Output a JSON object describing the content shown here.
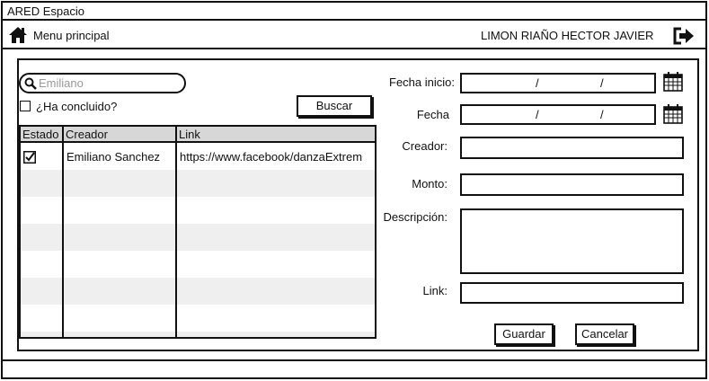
{
  "window": {
    "title": "ARED Espacio"
  },
  "nav": {
    "menu_label": "Menu principal",
    "user_name": "LIMON RIAÑO HECTOR JAVIER"
  },
  "search": {
    "value": "Emiliano",
    "checkbox_label": "¿Ha concluido?",
    "checked": false,
    "button_label": "Buscar"
  },
  "table": {
    "headers": [
      "Estado",
      "Creador",
      "Link"
    ],
    "rows": [
      {
        "estado_checked": true,
        "creador": "Emiliano Sanchez",
        "link": "https://www.facebook/danzaExtrem"
      },
      {
        "estado_checked": false,
        "creador": "",
        "link": ""
      },
      {
        "estado_checked": false,
        "creador": "",
        "link": ""
      },
      {
        "estado_checked": false,
        "creador": "",
        "link": ""
      },
      {
        "estado_checked": false,
        "creador": "",
        "link": ""
      },
      {
        "estado_checked": false,
        "creador": "",
        "link": ""
      },
      {
        "estado_checked": false,
        "creador": "",
        "link": ""
      },
      {
        "estado_checked": false,
        "creador": "",
        "link": ""
      }
    ]
  },
  "form": {
    "fecha_inicio_label": "Fecha inicio:",
    "fecha_label": "Fecha",
    "date_separator": "/",
    "creador_label": "Creador:",
    "monto_label": "Monto:",
    "descripcion_label": "Descripción:",
    "link_label": "Link:",
    "save_label": "Guardar",
    "cancel_label": "Cancelar"
  },
  "icons": {
    "home": "home-icon",
    "logout": "logout-icon",
    "search": "search-icon",
    "calendar": "calendar-icon",
    "checkmark": "checkmark-icon"
  }
}
